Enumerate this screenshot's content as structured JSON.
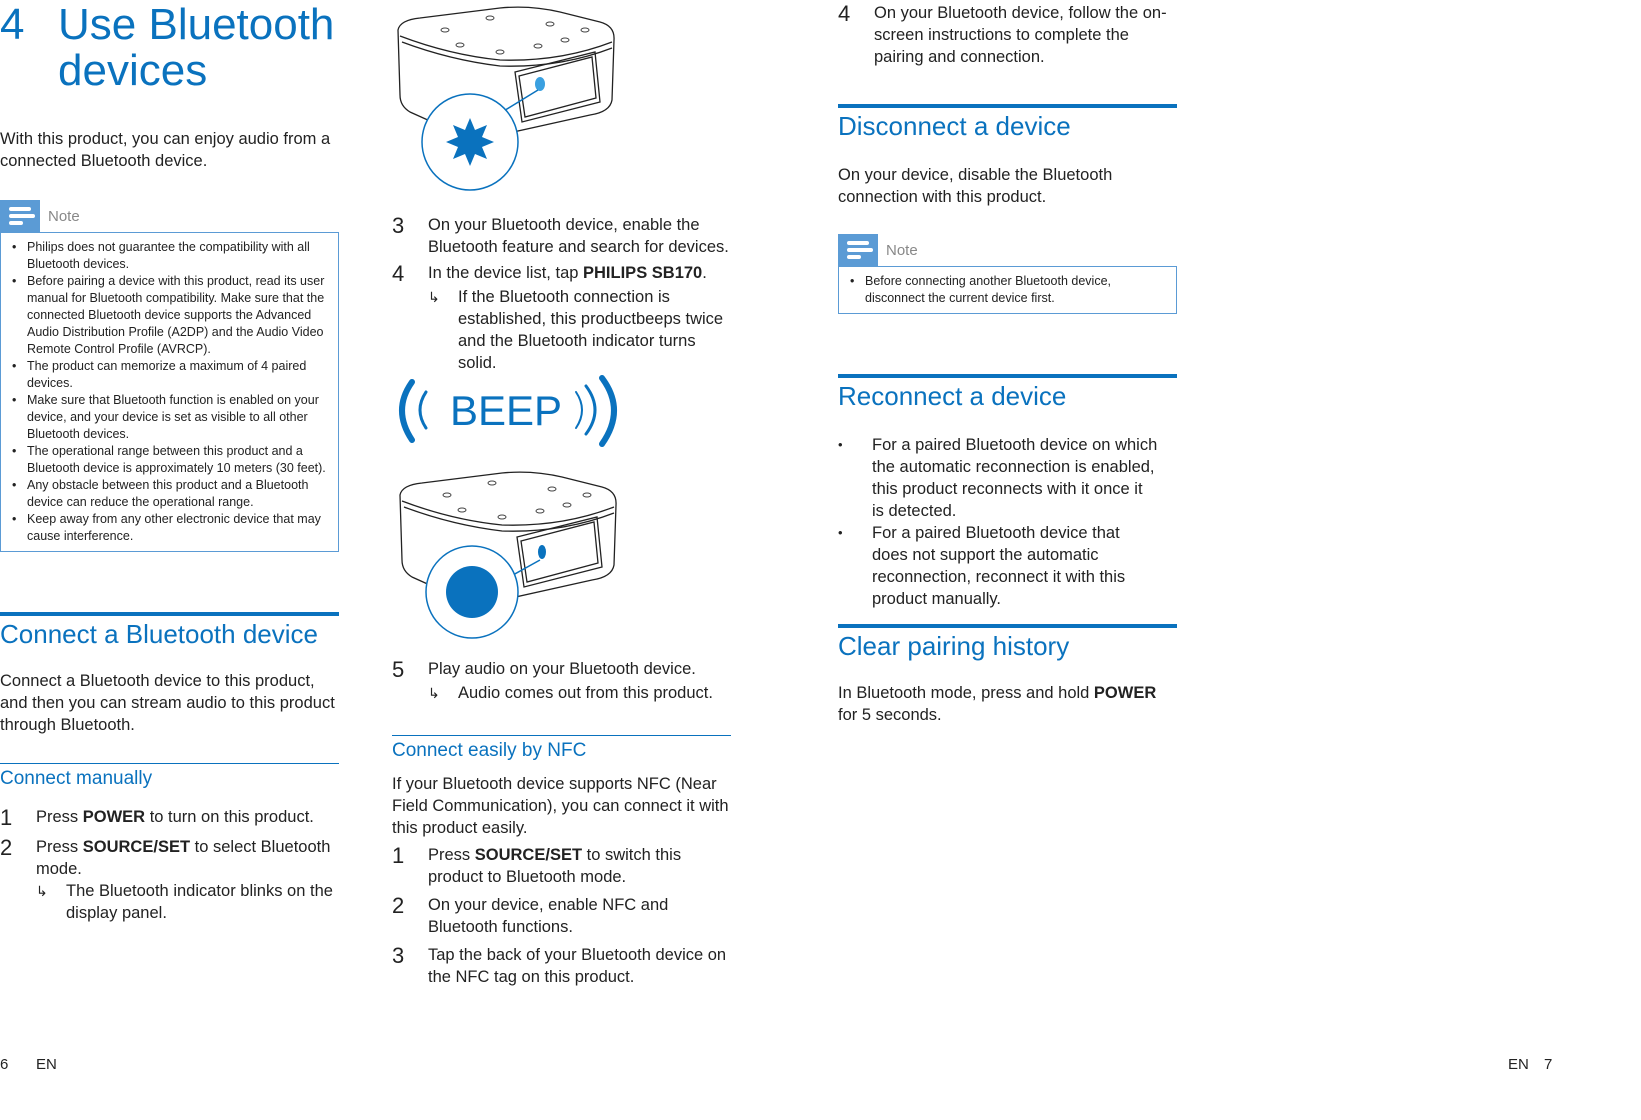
{
  "left_page": {
    "chapter_number": "4",
    "chapter_title_line1": "Use Bluetooth",
    "chapter_title_line2": "devices",
    "intro": "With this product, you can enjoy audio from a connected Bluetooth device.",
    "note": {
      "label": "Note",
      "items": [
        "Philips does not guarantee the compatibility with all Bluetooth devices.",
        "Before pairing a device with this product, read its user manual for Bluetooth compatibility. Make sure that the connected Bluetooth device supports the Advanced Audio Distribution Profile (A2DP) and the Audio Video Remote Control Profile (AVRCP).",
        "The product can memorize a maximum of 4 paired devices.",
        "Make sure that Bluetooth function is enabled on your device, and your device is set as visible to all other Bluetooth devices.",
        "The operational range between this product and a Bluetooth device is approximately 10 meters (30 feet).",
        "Any obstacle between this product and a Bluetooth device can reduce the operational range.",
        "Keep away from any other electronic device that may cause interference."
      ]
    },
    "connect_section": {
      "title": "Connect a Bluetooth device",
      "intro": "Connect a Bluetooth device to this product, and then you can stream audio to this product through Bluetooth.",
      "manual_title": "Connect manually",
      "steps": [
        {
          "num": "1",
          "pre": "Press ",
          "bold": "POWER",
          "post": " to turn on this product."
        },
        {
          "num": "2",
          "pre": "Press ",
          "bold": "SOURCE/SET",
          "post": " to select Bluetooth mode."
        }
      ],
      "step2_result": "The Bluetooth indicator blinks on the display panel."
    },
    "footer": {
      "page_number": "6",
      "lang": "EN"
    }
  },
  "middle_column": {
    "illustration1": {
      "description": "speaker with blinking Bluetooth indicator"
    },
    "step3": {
      "num": "3",
      "text": "On your Bluetooth device, enable the Bluetooth feature and search for devices."
    },
    "step4": {
      "num": "4",
      "pre": "In the device list, tap ",
      "bold": "PHILIPS SB170",
      "post": ".",
      "result": "If the Bluetooth connection is established, this productbeeps twice and the Bluetooth indicator turns solid."
    },
    "illustration2": {
      "beep_label": "BEEP"
    },
    "step5": {
      "num": "5",
      "text": "Play audio on your Bluetooth device.",
      "result": "Audio comes out from this product."
    },
    "nfc": {
      "title": "Connect easily by NFC",
      "intro": "If your Bluetooth device supports NFC (Near Field Communication), you can connect it with this product easily.",
      "steps": [
        {
          "num": "1",
          "pre": "Press ",
          "bold": "SOURCE/SET",
          "post": " to switch this product to Bluetooth mode."
        },
        {
          "num": "2",
          "pre": "On your device, enable NFC and Bluetooth functions.",
          "bold": "",
          "post": ""
        },
        {
          "num": "3",
          "pre": "Tap the back of your Bluetooth device on the NFC tag on this product.",
          "bold": "",
          "post": ""
        }
      ]
    }
  },
  "right_page": {
    "step4": {
      "num": "4",
      "text": "On your Bluetooth device, follow the on-screen instructions to complete the pairing and connection."
    },
    "disconnect": {
      "title": "Disconnect a device",
      "text": "On your device, disable the Bluetooth connection with this product.",
      "note_label": "Note",
      "note_item": "Before connecting another Bluetooth device, disconnect the current device first."
    },
    "reconnect": {
      "title": "Reconnect a device",
      "items": [
        "For a paired Bluetooth device on which the automatic reconnection is enabled, this product reconnects with it once it is detected.",
        "For a paired Bluetooth device that does not support the automatic reconnection, reconnect it with this product manually."
      ]
    },
    "clear": {
      "title": "Clear pairing history",
      "pre": "In Bluetooth mode, press and hold ",
      "bold": "POWER",
      "post": " for 5 seconds."
    },
    "footer": {
      "lang": "EN",
      "page_number": "7"
    }
  },
  "colors": {
    "accent": "#0a72be",
    "note": "#5b9bd5"
  }
}
